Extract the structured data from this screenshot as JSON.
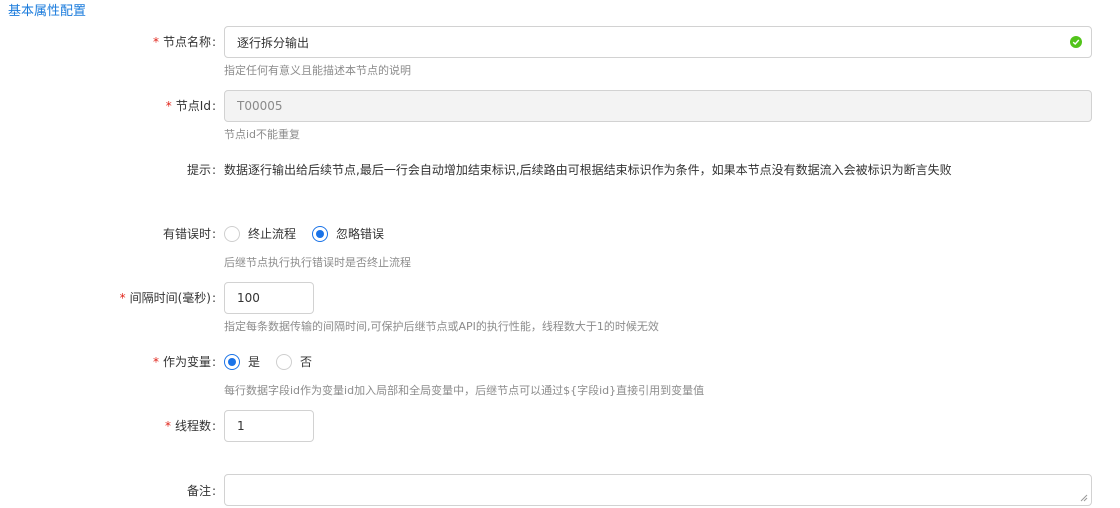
{
  "section": {
    "title": "基本属性配置"
  },
  "node_name": {
    "label": "节点名称",
    "value": "逐行拆分输出",
    "help": "指定任何有意义且能描述本节点的说明",
    "valid_icon": "check-circle-icon",
    "valid_color": "#52c41a"
  },
  "node_id": {
    "label": "节点Id",
    "value": "T00005",
    "help": "节点id不能重复"
  },
  "hint": {
    "label": "提示",
    "text": "数据逐行输出给后续节点,最后一行会自动增加结束标识,后续路由可根据结束标识作为条件，如果本节点没有数据流入会被标识为断言失败"
  },
  "on_error": {
    "label": "有错误时",
    "options": [
      {
        "label": "终止流程",
        "checked": false
      },
      {
        "label": "忽略错误",
        "checked": true
      }
    ],
    "help": "后继节点执行执行错误时是否终止流程"
  },
  "interval": {
    "label": "间隔时间(毫秒)",
    "value": "100",
    "help": "指定每条数据传输的间隔时间,可保护后继节点或API的执行性能，线程数大于1的时候无效"
  },
  "as_variable": {
    "label": "作为变量",
    "options": [
      {
        "label": "是",
        "checked": true
      },
      {
        "label": "否",
        "checked": false
      }
    ],
    "help": "每行数据字段id作为变量id加入局部和全局变量中，后继节点可以通过${字段id}直接引用到变量值"
  },
  "threads": {
    "label": "线程数",
    "value": "1"
  },
  "remark": {
    "label": "备注",
    "value": ""
  },
  "colors": {
    "accent": "#1a73e8",
    "title": "#1a7bdc",
    "required": "#e1251b"
  }
}
